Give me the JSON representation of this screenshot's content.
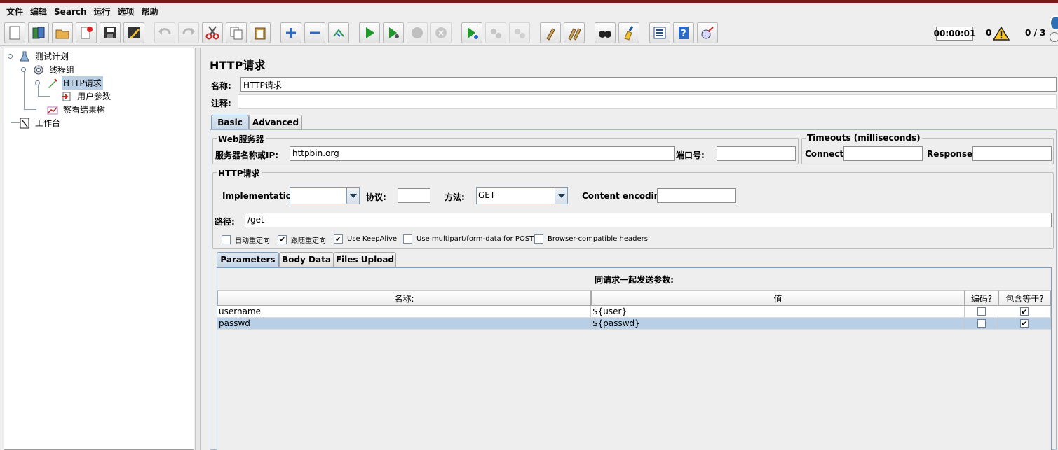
{
  "menu": [
    "文件",
    "编辑",
    "Search",
    "运行",
    "选项",
    "帮助"
  ],
  "toolbar": {
    "timer": "00:00:01",
    "error_count": "0",
    "threads": "0 / 3",
    "buttons": [
      {
        "name": "new-icon"
      },
      {
        "name": "templates-icon"
      },
      {
        "name": "open-icon"
      },
      {
        "name": "close-icon"
      },
      {
        "name": "save-icon"
      },
      {
        "name": "save-as-icon"
      },
      {
        "name": "undo-icon"
      },
      {
        "name": "redo-icon"
      },
      {
        "name": "cut-icon"
      },
      {
        "name": "copy-icon"
      },
      {
        "name": "paste-icon"
      },
      {
        "name": "expand-icon"
      },
      {
        "name": "collapse-icon"
      },
      {
        "name": "toggle-icon"
      },
      {
        "name": "start-icon"
      },
      {
        "name": "start-no-pause-icon"
      },
      {
        "name": "stop-icon"
      },
      {
        "name": "shutdown-icon"
      },
      {
        "name": "remote-start-icon"
      },
      {
        "name": "remote-stop-icon"
      },
      {
        "name": "remote-shutdown-icon"
      },
      {
        "name": "clear-icon"
      },
      {
        "name": "clear-all-icon"
      },
      {
        "name": "search-icon"
      },
      {
        "name": "reset-search-icon"
      },
      {
        "name": "function-helper-icon"
      },
      {
        "name": "help-icon"
      },
      {
        "name": "logger-icon"
      }
    ]
  },
  "tree": {
    "items": [
      {
        "label": "测试计划",
        "icon": "test-plan-icon"
      },
      {
        "label": "线程组",
        "icon": "thread-group-icon"
      },
      {
        "label": "HTTP请求",
        "icon": "http-sampler-icon",
        "selected": true
      },
      {
        "label": "用户参数",
        "icon": "user-params-icon"
      },
      {
        "label": "察看结果树",
        "icon": "result-tree-icon"
      },
      {
        "label": "工作台",
        "icon": "workbench-icon"
      }
    ]
  },
  "panel": {
    "title": "HTTP请求",
    "name_label": "名称:",
    "name_value": "HTTP请求",
    "comment_label": "注释:",
    "comment_value": "",
    "tabs": [
      "Basic",
      "Advanced"
    ],
    "web_server": {
      "group_title": "Web服务器",
      "server_label": "服务器名称或IP:",
      "server_value": "httpbin.org",
      "port_label": "端口号:",
      "port_value": ""
    },
    "timeouts": {
      "group_title": "Timeouts (milliseconds)",
      "connect_label": "Connect:",
      "connect_value": "",
      "response_label": "Response:",
      "response_value": ""
    },
    "http_request": {
      "group_title": "HTTP请求",
      "impl_label": "Implementation:",
      "impl_value": "",
      "protocol_label": "协议:",
      "protocol_value": "",
      "method_label": "方法:",
      "method_value": "GET",
      "encoding_label": "Content encoding:",
      "encoding_value": "",
      "path_label": "路径:",
      "path_value": "/get"
    },
    "options": [
      {
        "label": "自动重定向",
        "checked": false
      },
      {
        "label": "跟随重定向",
        "checked": true
      },
      {
        "label": "Use KeepAlive",
        "checked": true
      },
      {
        "label": "Use multipart/form-data for POST",
        "checked": false
      },
      {
        "label": "Browser-compatible headers",
        "checked": false
      }
    ],
    "sub_tabs": [
      "Parameters",
      "Body Data",
      "Files Upload"
    ],
    "params": {
      "caption": "同请求一起发送参数:",
      "columns": [
        "名称:",
        "值",
        "编码?",
        "包含等于?"
      ],
      "rows": [
        {
          "name": "username",
          "value": "${user}",
          "encode": false,
          "include_equals": true
        },
        {
          "name": "passwd",
          "value": "${passwd}",
          "encode": false,
          "include_equals": true,
          "selected": true
        }
      ]
    }
  }
}
